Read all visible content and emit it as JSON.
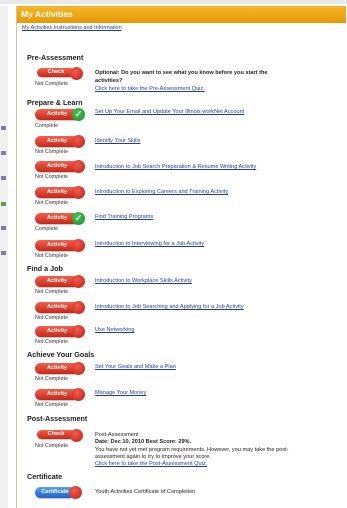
{
  "header": {
    "title": "My Activities"
  },
  "instructions_link": "My Activities Instructions and Information",
  "pre": {
    "heading": "Pre-Assessment",
    "button": "Check",
    "status": "Not Complete",
    "question_line1": "Optional: Do you want to see what you know before you start the",
    "question_line2": "activities?",
    "quiz_link": "Click here to take the Pre-Assessment Quiz."
  },
  "sections": {
    "prepare": "Prepare & Learn",
    "find_job": "Find a Job",
    "goals": "Achieve Your Goals"
  },
  "activity_label": "Activity",
  "activities": [
    {
      "status": "Complete",
      "link": "Set Up Your Email and Update Your Illinois workNet Account"
    },
    {
      "status": "Not Complete",
      "link": "Identify Your Skills"
    },
    {
      "status": "Not Complete",
      "link": "Introduction to Job Search Preparation & Resume Writing Activity"
    },
    {
      "status": "Not Complete",
      "link": "Introduction to Exploring Careers and Training Activity"
    },
    {
      "status": "Complete",
      "link": "Find Training Programs"
    },
    {
      "status": "Not Complete",
      "link": "Introduction to Interviewing for a Job Activity"
    },
    {
      "status": "Not Complete",
      "link": "Introduction to Workplace Skills Activity"
    },
    {
      "status": "Not Complete",
      "link": "Introduction to Job Searching and Applying for a Job Activity"
    },
    {
      "status": "Not Complete",
      "link": "Use Networking"
    },
    {
      "status": "Not Complete",
      "link": "Set Your Goals and Make a Plan"
    },
    {
      "status": "Not Complete",
      "link": "Manage Your Money"
    }
  ],
  "post": {
    "heading": "Post-Assessment",
    "button": "Check",
    "status": "Not Complete",
    "title": "Post-Assessment",
    "date_score": "Date: Dec 10, 2010 Best Score: 29%.",
    "note_line1": "You have not yet met program requirements. However, you may take the post-",
    "note_line2": "assessment again to try to improve your score.",
    "quiz_link": "Click here to take the Post-Assessment Quiz."
  },
  "certificate": {
    "heading": "Certificate",
    "button": "Certificate",
    "text": "Youth Activities Certificate of Completion"
  },
  "colors": {
    "header": "#e59a06",
    "link": "#233d9b",
    "button_red": "#c7271a",
    "check_green": "#1f8d2f",
    "cert_blue": "#1f63c9"
  }
}
